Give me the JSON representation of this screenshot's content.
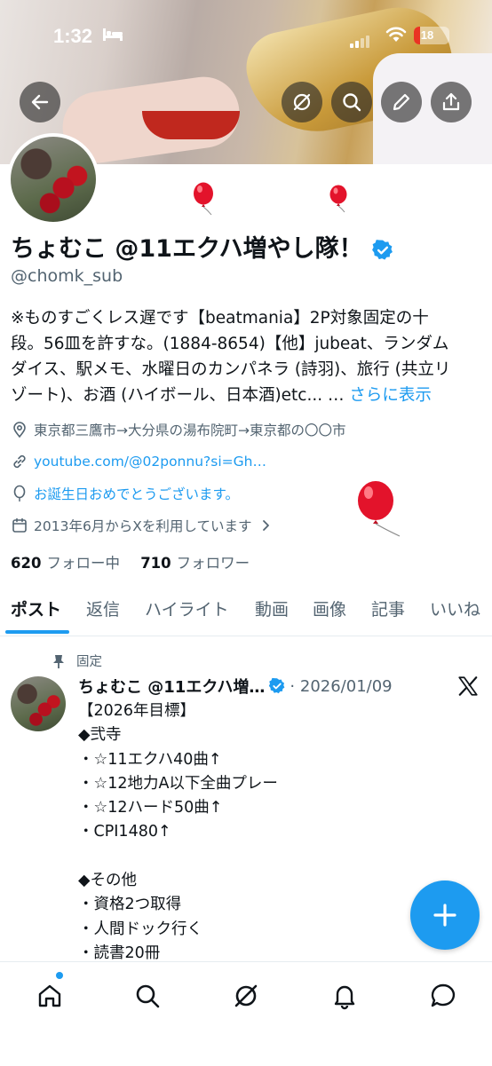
{
  "status_bar": {
    "time": "1:32",
    "battery": "18",
    "battery_level": 0.18
  },
  "banner_actions": {
    "back": "back-arrow-icon",
    "grok": "grok-icon",
    "search": "search-icon",
    "edit": "pencil-icon",
    "share": "share-icon"
  },
  "profile": {
    "display_name": "ちょむこ @11エクハ増やし隊！",
    "handle": "@chomk_sub",
    "bio_line1": "※ものすごくレス遅です【beatmania】2P対象固定の十",
    "bio_line2": "段。56皿を許すな。(1884-8654)【他】jubeat、ランダム",
    "bio_line3": "ダイス、駅メモ、水曜日のカンパネラ (詩羽)、旅行 (共立リ",
    "bio_line4_text": "ゾート)、お酒 (ハイボール、日本酒)etc... … ",
    "bio_more": "さらに表示",
    "location": "東京都三鷹市→大分県の湯布院町→東京都の〇〇市",
    "website": "youtube.com/@02ponnu?si=Gh…",
    "birthday": "お誕生日おめでとうございます。",
    "joined": "2013年6月からXを利用しています",
    "following_count": "620",
    "following_label": "フォロー中",
    "followers_count": "710",
    "followers_label": "フォロワー"
  },
  "tabs": [
    "ポスト",
    "返信",
    "ハイライト",
    "動画",
    "画像",
    "記事",
    "いいね"
  ],
  "active_tab": "ポスト",
  "pinned_post": {
    "pinned_label": "固定",
    "author": "ちょむこ @11エクハ増…",
    "date": "· 2026/01/09",
    "body": "【2026年目標】\n◆弐寺\n・☆11エクハ40曲↑\n・☆12地力A以下全曲プレー\n・☆12ハード50曲↑\n・CPI1480↑\n\n◆その他\n・資格2つ取得\n・人間ドック行く\n・読書20冊"
  },
  "fab": "plus-icon",
  "bottom_nav": [
    "home-icon",
    "search-icon",
    "grok-icon",
    "bell-icon",
    "messages-icon"
  ],
  "colors": {
    "accent": "#1d9bf0",
    "text": "#0f1419",
    "secondary": "#536471",
    "balloon": "#e3132b"
  }
}
